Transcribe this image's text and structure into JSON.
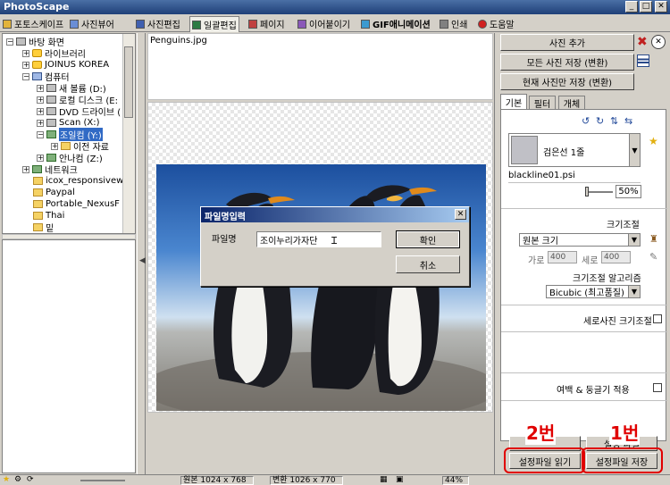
{
  "app": {
    "title": "PhotoScape",
    "min": "_",
    "max": "□",
    "close": "✕"
  },
  "tabs": [
    {
      "label": "포토스케이프"
    },
    {
      "label": "사진뷰어"
    },
    {
      "label": "사진편집"
    },
    {
      "label": "일괄편집"
    },
    {
      "label": "페이지"
    },
    {
      "label": "이어붙이기"
    },
    {
      "label": "GIF애니메이션"
    },
    {
      "label": "인쇄"
    },
    {
      "label": "도움말"
    }
  ],
  "tree": {
    "items": [
      {
        "label": "바탕 화면",
        "pm": "−",
        "icon": "desktop"
      },
      {
        "label": "라이브러리",
        "pm": "+",
        "icon": "library"
      },
      {
        "label": "JOINUS KOREA",
        "pm": "+",
        "icon": "user"
      },
      {
        "label": "컴퓨터",
        "pm": "−",
        "icon": "pc"
      },
      {
        "label": "새 볼륨 (D:)",
        "pm": "+",
        "icon": "drive"
      },
      {
        "label": "로컬 디스크 (E:",
        "pm": "+",
        "icon": "drive"
      },
      {
        "label": "DVD 드라이브 (",
        "pm": "+",
        "icon": "drive"
      },
      {
        "label": "Scan (X:)",
        "pm": "+",
        "icon": "drive"
      },
      {
        "label": "조일컴 (Y:)",
        "pm": "−",
        "icon": "drive"
      },
      {
        "label": "이전 자료",
        "pm": "+",
        "icon": "folder"
      },
      {
        "label": "안나컴 (Z:)",
        "pm": "+",
        "icon": "drive"
      },
      {
        "label": "네트워크",
        "pm": "+",
        "icon": "net"
      },
      {
        "label": "icox_responsivewel",
        "pm": "",
        "icon": "folder"
      },
      {
        "label": "Paypal",
        "pm": "",
        "icon": "folder"
      },
      {
        "label": "Portable_NexusF",
        "pm": "",
        "icon": "folder"
      },
      {
        "label": "Thai",
        "pm": "",
        "icon": "folder"
      },
      {
        "label": "밑",
        "pm": "",
        "icon": "folder"
      }
    ]
  },
  "canvas": {
    "filename": "Penguins.jpg"
  },
  "dialog": {
    "title": "파일명입력",
    "label": "파일명",
    "value": "조이누리가자단",
    "ok": "확인",
    "cancel": "취소",
    "close": "✕"
  },
  "right": {
    "add_photo": "사진 추가",
    "save_all": "모든 사진 저장 (변환)",
    "save_current": "현재 사진만 저장 (변환)",
    "tabs": [
      "기본",
      "필터",
      "개체"
    ],
    "frame_name": "검은선 1줄",
    "frame_file": "blackline01.psi",
    "zoom": "50%",
    "resize_title": "크기조절",
    "resize_value": "원본 크기",
    "width_label": "가로",
    "width_value": "400",
    "height_label": "세로",
    "height_value": "400",
    "algo_title": "크기조절 알고리즘",
    "algo_value": "Bicubic (최고품질)",
    "portrait_label": "세로사진 크기조절",
    "margin_label": "여백 & 둥글기 적용",
    "partial_left": "",
    "partial_right": "설정 파일",
    "read_button": "설정파일 읽기",
    "save_button": "설정파일 저장"
  },
  "annotations": {
    "label_2": "2번",
    "label_1": "1번",
    "color": "#e00000"
  },
  "status": {
    "orig": "원본 1024 x 768",
    "changed": "변환 1026 x 770",
    "zoom": "44%"
  }
}
